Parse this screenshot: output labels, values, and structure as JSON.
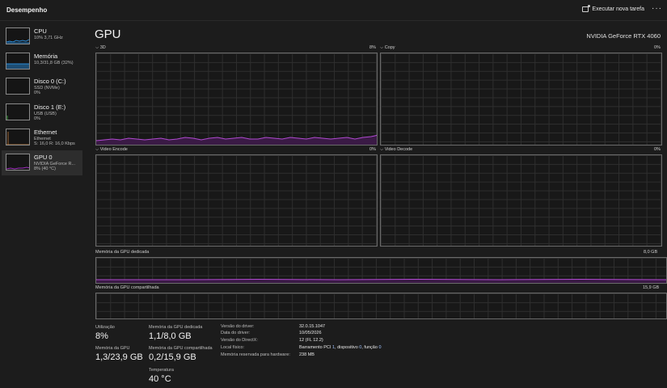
{
  "header": {
    "title": "Desempenho",
    "run_task_label": "Executar nova tarefa",
    "more_label": "···"
  },
  "sidebar": {
    "items": [
      {
        "name": "CPU",
        "line1": "10% 3,71 GHz",
        "line2": "",
        "color": "#2b8ad6"
      },
      {
        "name": "Memória",
        "line1": "10,3/31,8 GB (32%)",
        "line2": "",
        "color": "#2b8ad6"
      },
      {
        "name": "Disco 0 (C:)",
        "line1": "SSD (NVMe)",
        "line2": "0%",
        "color": "#3a9b3a"
      },
      {
        "name": "Disco 1 (E:)",
        "line1": "USB (USB)",
        "line2": "0%",
        "color": "#3a9b3a"
      },
      {
        "name": "Ethernet",
        "line1": "Ethernet",
        "line2": "S: 16,0 R: 16,0 Kbps",
        "color": "#c07a3a"
      },
      {
        "name": "GPU 0",
        "line1": "NVIDIA GeForce R...",
        "line2": "8% (40 °C)",
        "color": "#a02fbf"
      }
    ]
  },
  "gpu": {
    "title": "GPU",
    "model": "NVIDIA GeForce RTX 4060",
    "graphs": [
      {
        "name": "3D",
        "value": "8%"
      },
      {
        "name": "Copy",
        "value": "0%"
      },
      {
        "name": "Video Encode",
        "value": "0%"
      },
      {
        "name": "Video Decode",
        "value": "0%"
      }
    ],
    "dedicated_memory": {
      "label": "Memória da GPU dedicada",
      "max": "8,0 GB"
    },
    "shared_memory": {
      "label": "Memória da GPU compartilhada",
      "max": "15,9 GB"
    },
    "line_color": "#b04ad0"
  },
  "stats": {
    "utilization": {
      "label": "Utilização",
      "value": "8%"
    },
    "gpu_memory": {
      "label": "Memória da GPU",
      "value": "1,3/23,9 GB"
    },
    "dedicated": {
      "label": "Memória da GPU dedicada",
      "value": "1,1/8,0 GB"
    },
    "shared": {
      "label": "Memória da GPU compartilhada",
      "value": "0,2/15,9 GB"
    },
    "temperature": {
      "label": "Temperatura",
      "value": "40 °C"
    }
  },
  "info": {
    "driver_version": {
      "label": "Versão do driver:",
      "value": "32.0.15.1047"
    },
    "driver_date": {
      "label": "Data do driver:",
      "value": "10/05/2026"
    },
    "directx": {
      "label": "Versão do DirectX:",
      "value": "12 (FL 12.2)"
    },
    "physical_location": {
      "label": "Local físico:",
      "value_prefix": "Barramento PCI ",
      "bus": "1",
      "mid1": ", dispositivo ",
      "device": "0",
      "mid2": ", função ",
      "function": "0"
    },
    "reserved_memory": {
      "label": "Memória reservada para hardware:",
      "value": "238 MB"
    }
  }
}
